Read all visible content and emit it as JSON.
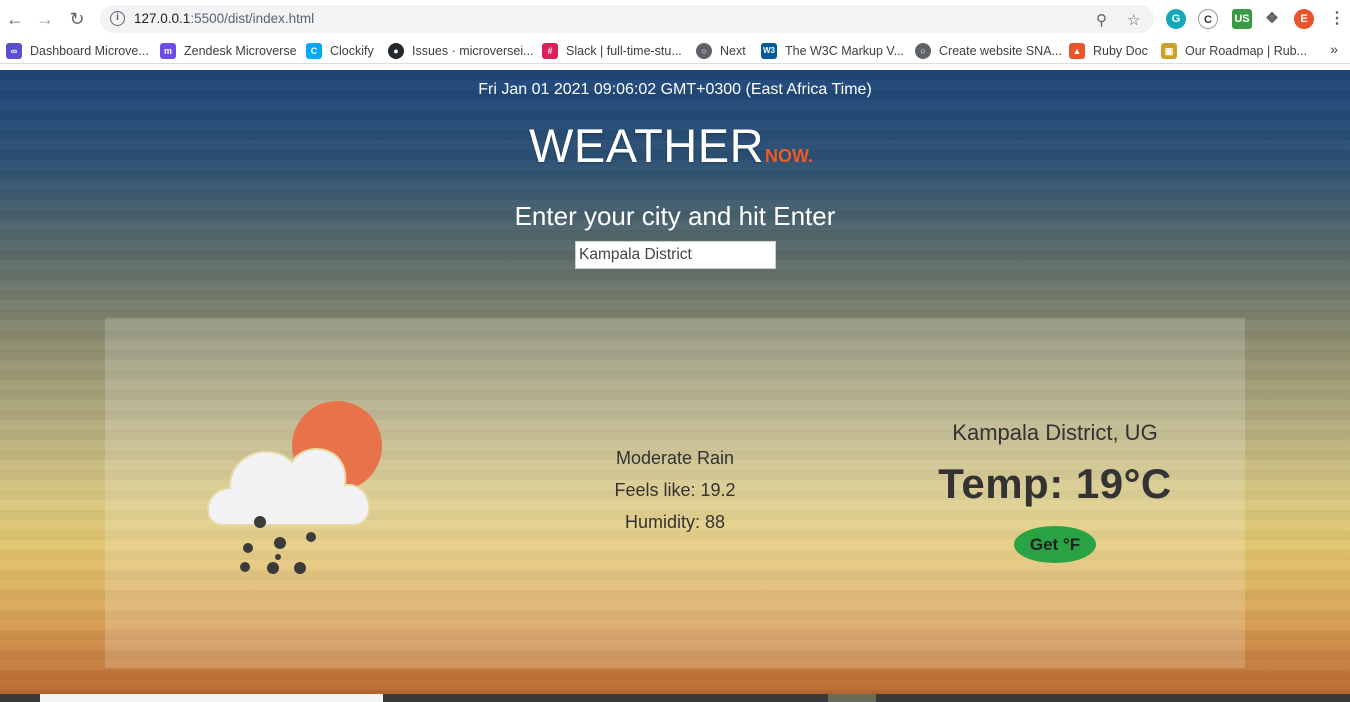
{
  "browser": {
    "url_host": "127.0.0.1",
    "url_path": ":5500/dist/index.html",
    "profile_initial": "E",
    "bookmarks": [
      {
        "label": "Dashboard Microve...",
        "color": "#5a4fcf",
        "glyph": "∞"
      },
      {
        "label": "Zendesk Microverse",
        "color": "#6b4ce6",
        "glyph": "m"
      },
      {
        "label": "Clockify",
        "color": "#03a9f4",
        "glyph": "C"
      },
      {
        "label": "Issues · microversei...",
        "color": "#24292e",
        "glyph": "●"
      },
      {
        "label": "Slack | full-time-stu...",
        "color": "#e01e5a",
        "glyph": "#"
      },
      {
        "label": "Next",
        "color": "#5f6368",
        "glyph": "○"
      },
      {
        "label": "The W3C Markup V...",
        "color": "#005a9c",
        "glyph": "W3"
      },
      {
        "label": "Create website SNA...",
        "color": "#5f6368",
        "glyph": "○"
      },
      {
        "label": "Ruby Doc",
        "color": "#e8552b",
        "glyph": "▲"
      },
      {
        "label": "Our Roadmap | Rub...",
        "color": "#c9a227",
        "glyph": "▣"
      }
    ]
  },
  "app": {
    "datetime": "Fri Jan 01 2021 09:06:02 GMT+0300 (East Africa Time)",
    "brand_main": "WEATHER",
    "brand_sub": "NOW.",
    "prompt": "Enter your city and hit Enter",
    "city_value": "Kampala District",
    "weather": {
      "icon": "cloud-sun-rain-icon",
      "description": "Moderate Rain",
      "feels_like": "Feels like: 19.2",
      "humidity": "Humidity: 88",
      "location": "Kampala District, UG",
      "temp": "Temp: 19°C",
      "toggle_label": "Get °F",
      "toggle_color": "#29a343"
    }
  }
}
